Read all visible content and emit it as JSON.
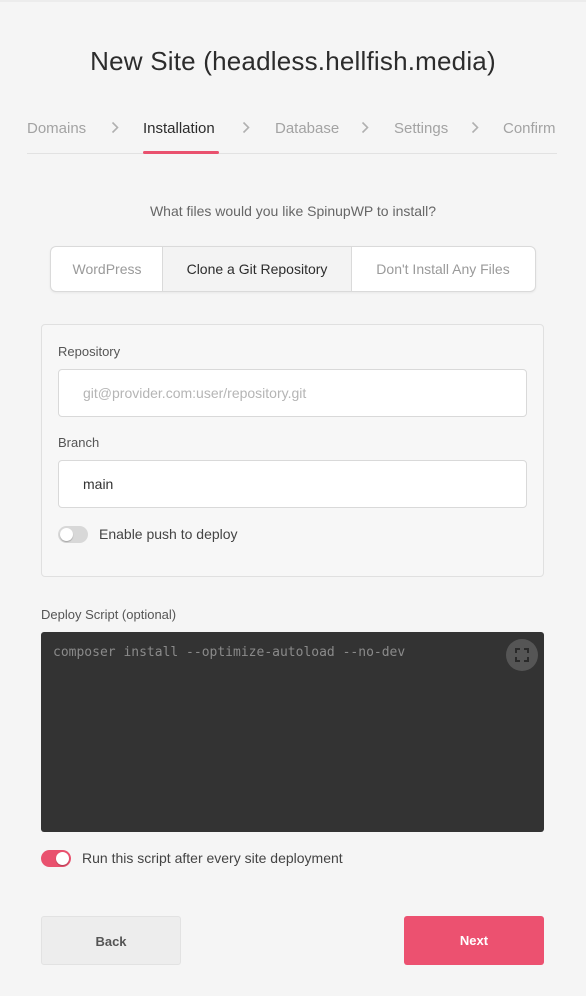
{
  "page": {
    "title": "New Site (headless.hellfish.media)"
  },
  "steps": [
    {
      "label": "Domains",
      "active": false
    },
    {
      "label": "Installation",
      "active": true
    },
    {
      "label": "Database",
      "active": false
    },
    {
      "label": "Settings",
      "active": false
    },
    {
      "label": "Confirm",
      "active": false
    }
  ],
  "install": {
    "question": "What files would you like SpinupWP to install?",
    "options": [
      "WordPress",
      "Clone a Git Repository",
      "Don't Install Any Files"
    ],
    "selected": "Clone a Git Repository"
  },
  "repo": {
    "repository_label": "Repository",
    "repository_placeholder": "git@provider.com:user/repository.git",
    "repository_value": "",
    "branch_label": "Branch",
    "branch_value": "main",
    "push_to_deploy_label": "Enable push to deploy",
    "push_to_deploy_enabled": false
  },
  "deploy": {
    "label": "Deploy Script (optional)",
    "placeholder": "composer install --optimize-autoload --no-dev",
    "run_after_deploy_label": "Run this script after every site deployment",
    "run_after_deploy_enabled": true
  },
  "actions": {
    "back_label": "Back",
    "next_label": "Next"
  },
  "colors": {
    "accent": "#e9516e",
    "background": "#f5f5f5",
    "editor_bg": "#333333"
  },
  "icons": {
    "step_separator": "chevron-right-icon",
    "editor_fullscreen": "fullscreen-icon"
  }
}
